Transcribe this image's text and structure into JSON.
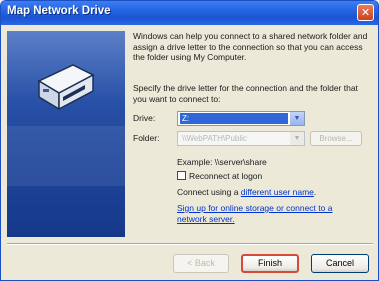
{
  "window": {
    "title": "Map Network Drive",
    "close_glyph": "✕"
  },
  "content": {
    "description": "Windows can help you connect to a shared network folder and assign a drive letter to the connection so that you can access the folder using My Computer.",
    "instruction": "Specify the drive letter for the connection and the folder that you want to connect to:",
    "drive": {
      "label": "Drive:",
      "value": "Z:"
    },
    "folder": {
      "label": "Folder:",
      "value": "\\\\WebPATH\\Public"
    },
    "browse_label": "Browse...",
    "example": "Example: \\\\server\\share",
    "reconnect_label": "Reconnect at logon",
    "connect_prefix": "Connect using a ",
    "connect_link": "different user name",
    "connect_suffix": ".",
    "signup_link": "Sign up for online storage or connect to a network server."
  },
  "footer": {
    "back_label": "< Back",
    "finish_label": "Finish",
    "cancel_label": "Cancel"
  },
  "icons": {
    "wizard": "network-drive-icon",
    "dropdown": "chevron-down-icon"
  },
  "colors": {
    "titlebar": "#2261e0",
    "panel": "#2750a6",
    "selection": "#3166d6",
    "link": "#0033cc",
    "default_button_ring": "#d64a3a"
  }
}
